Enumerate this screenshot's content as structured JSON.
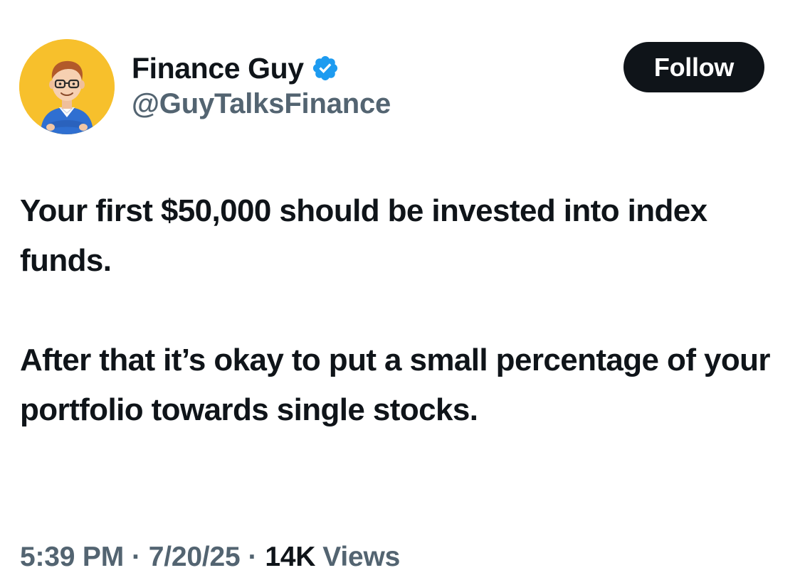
{
  "author": {
    "display_name": "Finance Guy",
    "handle": "@GuyTalksFinance",
    "verified": true,
    "avatar_icon": "cartoon-man-avatar",
    "verified_icon": "verified-badge-icon"
  },
  "actions": {
    "follow_label": "Follow"
  },
  "tweet": {
    "paragraphs": [
      "Your first $50,000 should be invested into index funds.",
      "After that it’s okay to put a small percentage of your portfolio towards single stocks."
    ]
  },
  "meta": {
    "time": "5:39 PM",
    "separator": "·",
    "date": "7/20/25",
    "views_count": "14K",
    "views_label": "Views"
  },
  "colors": {
    "text_primary": "#0f1419",
    "text_secondary": "#536471",
    "follow_bg": "#0f1419",
    "follow_text": "#ffffff",
    "verified_blue": "#1d9bf0",
    "avatar_bg": "#f7c02c"
  }
}
